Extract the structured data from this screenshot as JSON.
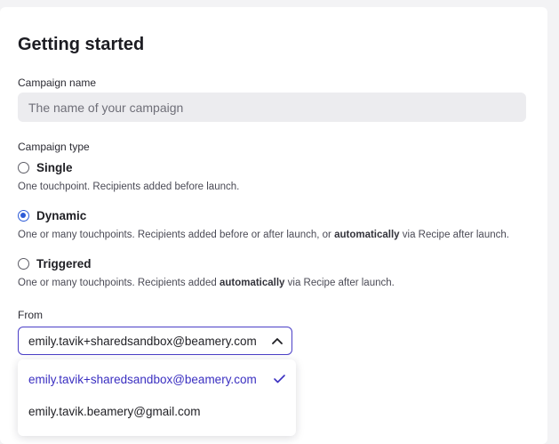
{
  "page": {
    "title": "Getting started"
  },
  "campaign_name": {
    "label": "Campaign name",
    "value": "",
    "placeholder": "The name of your campaign"
  },
  "campaign_type": {
    "label": "Campaign type",
    "selected": "Dynamic",
    "options": [
      {
        "label": "Single",
        "checked": false,
        "desc_parts": [
          "One touchpoint. Recipients added before launch."
        ]
      },
      {
        "label": "Dynamic",
        "checked": true,
        "desc_parts": [
          "One or many touchpoints. Recipients added before or after launch, or ",
          "automatically",
          " via Recipe after launch."
        ]
      },
      {
        "label": "Triggered",
        "checked": false,
        "desc_parts": [
          "One or many touchpoints. Recipients added ",
          "automatically",
          " via Recipe after launch."
        ]
      }
    ]
  },
  "from": {
    "label": "From",
    "value": "emily.tavik+sharedsandbox@beamery.com",
    "expanded": true,
    "options": [
      {
        "label": "emily.tavik+sharedsandbox@beamery.com",
        "selected": true
      },
      {
        "label": "emily.tavik.beamery@gmail.com",
        "selected": false
      }
    ]
  },
  "colors": {
    "accent": "#2d5bd7",
    "select_border": "#4b3fc7",
    "selected_option": "#3a2fc1",
    "input_bg": "#ececef"
  },
  "icons": {
    "radio": "radio-button",
    "chevron": "chevron-up-icon",
    "check": "checkmark-icon"
  }
}
